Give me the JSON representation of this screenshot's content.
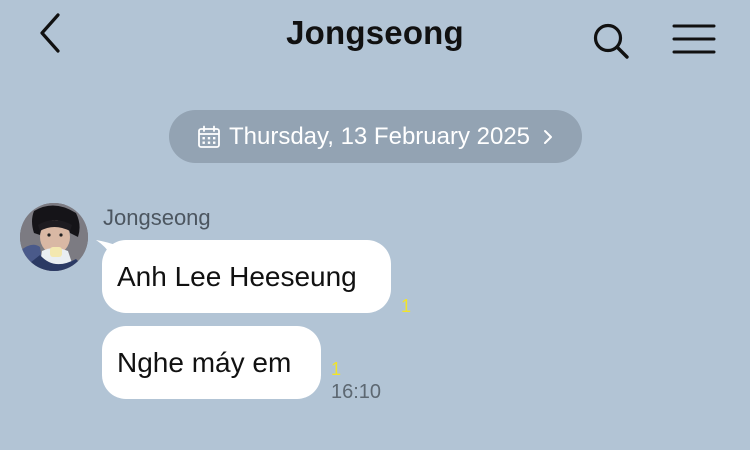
{
  "header": {
    "title": "Jongseong",
    "back_icon": "chevron-left-icon",
    "search_icon": "search-icon",
    "menu_icon": "hamburger-menu-icon"
  },
  "date_divider": {
    "label": "Thursday, 13 February 2025",
    "icon": "calendar-icon",
    "chevron": "chevron-right-icon"
  },
  "messages": {
    "sender_name": "Jongseong",
    "items": [
      {
        "text": "Anh Lee Heeseung",
        "unread": "1",
        "time": ""
      },
      {
        "text": "Nghe máy em",
        "unread": "1",
        "time": "16:10"
      }
    ]
  },
  "colors": {
    "background": "#b2c4d5",
    "date_pill": "#93a3b3",
    "bubble": "#ffffff",
    "unread": "#f1e42a"
  }
}
